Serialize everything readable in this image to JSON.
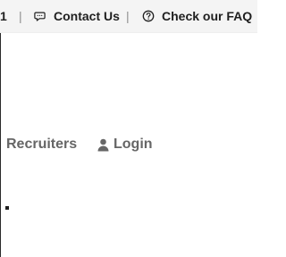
{
  "topbar": {
    "phone_fragment": "1",
    "separator": "|",
    "contact_label": "Contact Us",
    "faq_label": "Check our FAQ",
    "chat_icon": "chat-bubble-icon",
    "help_icon": "help-circle-icon"
  },
  "nav": {
    "recruiters_label": "Recruiters",
    "login_label": "Login",
    "recruiters_icon": "recruiters-icon",
    "login_icon": "user-icon"
  },
  "colors": {
    "topbar_background": "#f4f4f4",
    "topbar_text": "#1f1f1f",
    "nav_text": "#666666",
    "separator": "#8f8f8f"
  }
}
